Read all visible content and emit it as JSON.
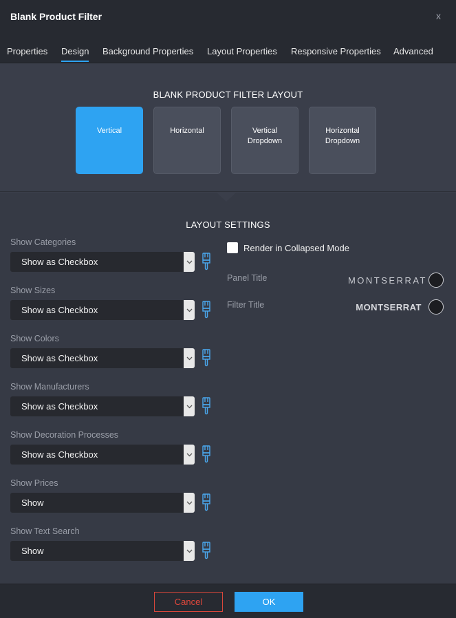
{
  "dialog": {
    "title": "Blank Product Filter",
    "close_label": "x"
  },
  "tabs": [
    {
      "label": "Properties"
    },
    {
      "label": "Design",
      "active": true
    },
    {
      "label": "Background Properties"
    },
    {
      "label": "Layout Properties"
    },
    {
      "label": "Responsive Properties"
    },
    {
      "label": "Advanced"
    }
  ],
  "layout": {
    "heading": "BLANK PRODUCT FILTER LAYOUT",
    "options": [
      {
        "label": "Vertical",
        "selected": true
      },
      {
        "label": "Horizontal"
      },
      {
        "label": "Vertical Dropdown"
      },
      {
        "label": "Horizontal Dropdown"
      }
    ]
  },
  "settings": {
    "heading": "LAYOUT SETTINGS",
    "fields": [
      {
        "label": "Show Categories",
        "value": "Show as Checkbox"
      },
      {
        "label": "Show Sizes",
        "value": "Show as Checkbox"
      },
      {
        "label": "Show Colors",
        "value": "Show as Checkbox"
      },
      {
        "label": "Show Manufacturers",
        "value": "Show as Checkbox"
      },
      {
        "label": "Show Decoration Processes",
        "value": "Show as Checkbox"
      },
      {
        "label": "Show Prices",
        "value": "Show"
      },
      {
        "label": "Show Text Search",
        "value": "Show"
      }
    ],
    "collapsed_mode": {
      "label": "Render in Collapsed Mode",
      "checked": false
    },
    "panel_title": {
      "label": "Panel Title",
      "font": "MONTSERRAT",
      "color": "#1c1d21"
    },
    "filter_title": {
      "label": "Filter Title",
      "font": "MONTSERRAT",
      "color": "#1c1d21"
    }
  },
  "footer": {
    "cancel_label": "Cancel",
    "ok_label": "OK"
  },
  "colors": {
    "accent": "#2ea3f2",
    "cancel": "#e0473b",
    "background": "#363a45"
  },
  "icons": {
    "dropdown": "chevron-down-icon",
    "style": "paint-brush-icon"
  }
}
